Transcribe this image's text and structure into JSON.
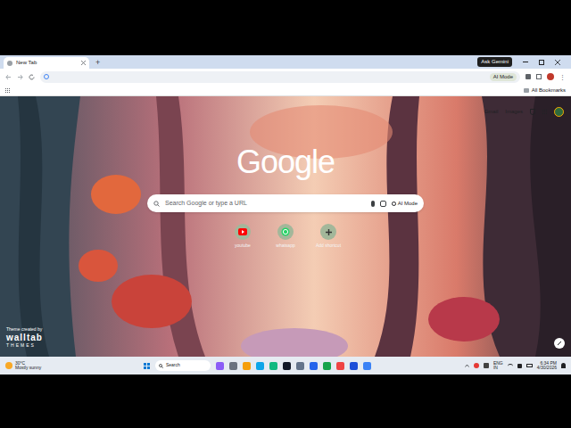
{
  "window": {
    "title": "New Tab"
  },
  "tabs": [
    {
      "label": "New Tab",
      "selected": true
    }
  ],
  "new_tab_button": "+",
  "toolbar": {
    "ask_gemini": "Ask Gemini",
    "address_placeholder": "",
    "ai_mode_pill": "AI Mode",
    "all_bookmarks": "All Bookmarks"
  },
  "page": {
    "top_links": [
      "Gmail",
      "Images"
    ],
    "logo": "Google",
    "search": {
      "placeholder": "Search Google or type a URL",
      "ai_mode": "AI Mode"
    },
    "shortcuts": [
      {
        "label": "youtube"
      },
      {
        "label": "whatsapp"
      },
      {
        "label": "Add shortcut"
      }
    ],
    "theme_credit": {
      "caption": "Theme created by",
      "brand": "walltab",
      "sub": "THEMES"
    }
  },
  "taskbar": {
    "weather": {
      "temp": "30°C",
      "condition": "Mostly sunny"
    },
    "search": "Search",
    "language": {
      "lang": "ENG",
      "region": "IN"
    },
    "time": "6:34 PM",
    "date": "4/30/2026"
  }
}
